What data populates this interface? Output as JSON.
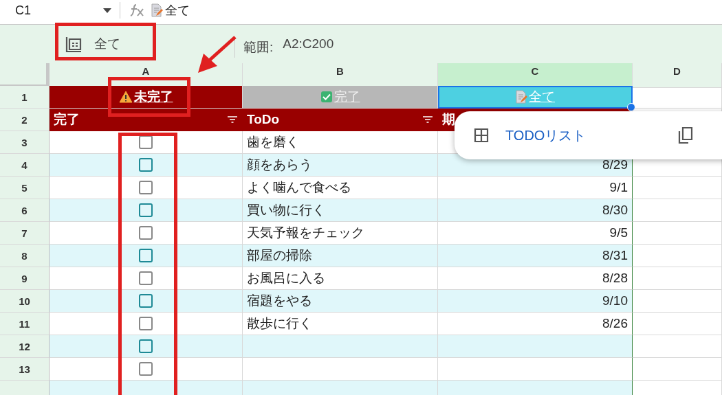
{
  "formula_bar": {
    "cell_ref": "C1",
    "formula": "全て"
  },
  "slicer": {
    "label": "全て",
    "range_label": "範囲:",
    "range": "A2:C200"
  },
  "columns": [
    {
      "label": "A",
      "selected": false
    },
    {
      "label": "B",
      "selected": false
    },
    {
      "label": "C",
      "selected": true
    },
    {
      "label": "D",
      "selected": false
    }
  ],
  "filter_row": {
    "row": "1",
    "cells": [
      {
        "label": "未完了",
        "kind": "warning",
        "color": "#990000",
        "selected": false
      },
      {
        "label": "完了",
        "kind": "check",
        "color": "#b7b7b7",
        "selected": false
      },
      {
        "label": "全て",
        "kind": "memo",
        "color": "#4dd0e1",
        "selected": true
      }
    ]
  },
  "header_row": {
    "row": "2",
    "cells": [
      {
        "label": "完了",
        "filter": true
      },
      {
        "label": "ToDo",
        "filter": true
      },
      {
        "label": "期"
      }
    ]
  },
  "rows": [
    {
      "row": "3",
      "checked": false,
      "task": "歯を磨く"
    },
    {
      "row": "4",
      "checked": false,
      "task": "顔をあらう",
      "due": "8/29"
    },
    {
      "row": "5",
      "checked": false,
      "task": "よく噛んで食べる",
      "due": "9/1"
    },
    {
      "row": "6",
      "checked": false,
      "task": "買い物に行く",
      "due": "8/30"
    },
    {
      "row": "7",
      "checked": false,
      "task": "天気予報をチェック",
      "due": "9/5"
    },
    {
      "row": "8",
      "checked": false,
      "task": "部屋の掃除",
      "due": "8/31"
    },
    {
      "row": "9",
      "checked": false,
      "task": "お風呂に入る",
      "due": "8/28"
    },
    {
      "row": "10",
      "checked": false,
      "task": "宿題をやる",
      "due": "9/10"
    },
    {
      "row": "11",
      "checked": false,
      "task": "散歩に行く",
      "due": "8/26"
    },
    {
      "row": "12",
      "checked": false
    },
    {
      "row": "13",
      "checked": false
    }
  ],
  "popup": {
    "title": "TODOリスト"
  }
}
